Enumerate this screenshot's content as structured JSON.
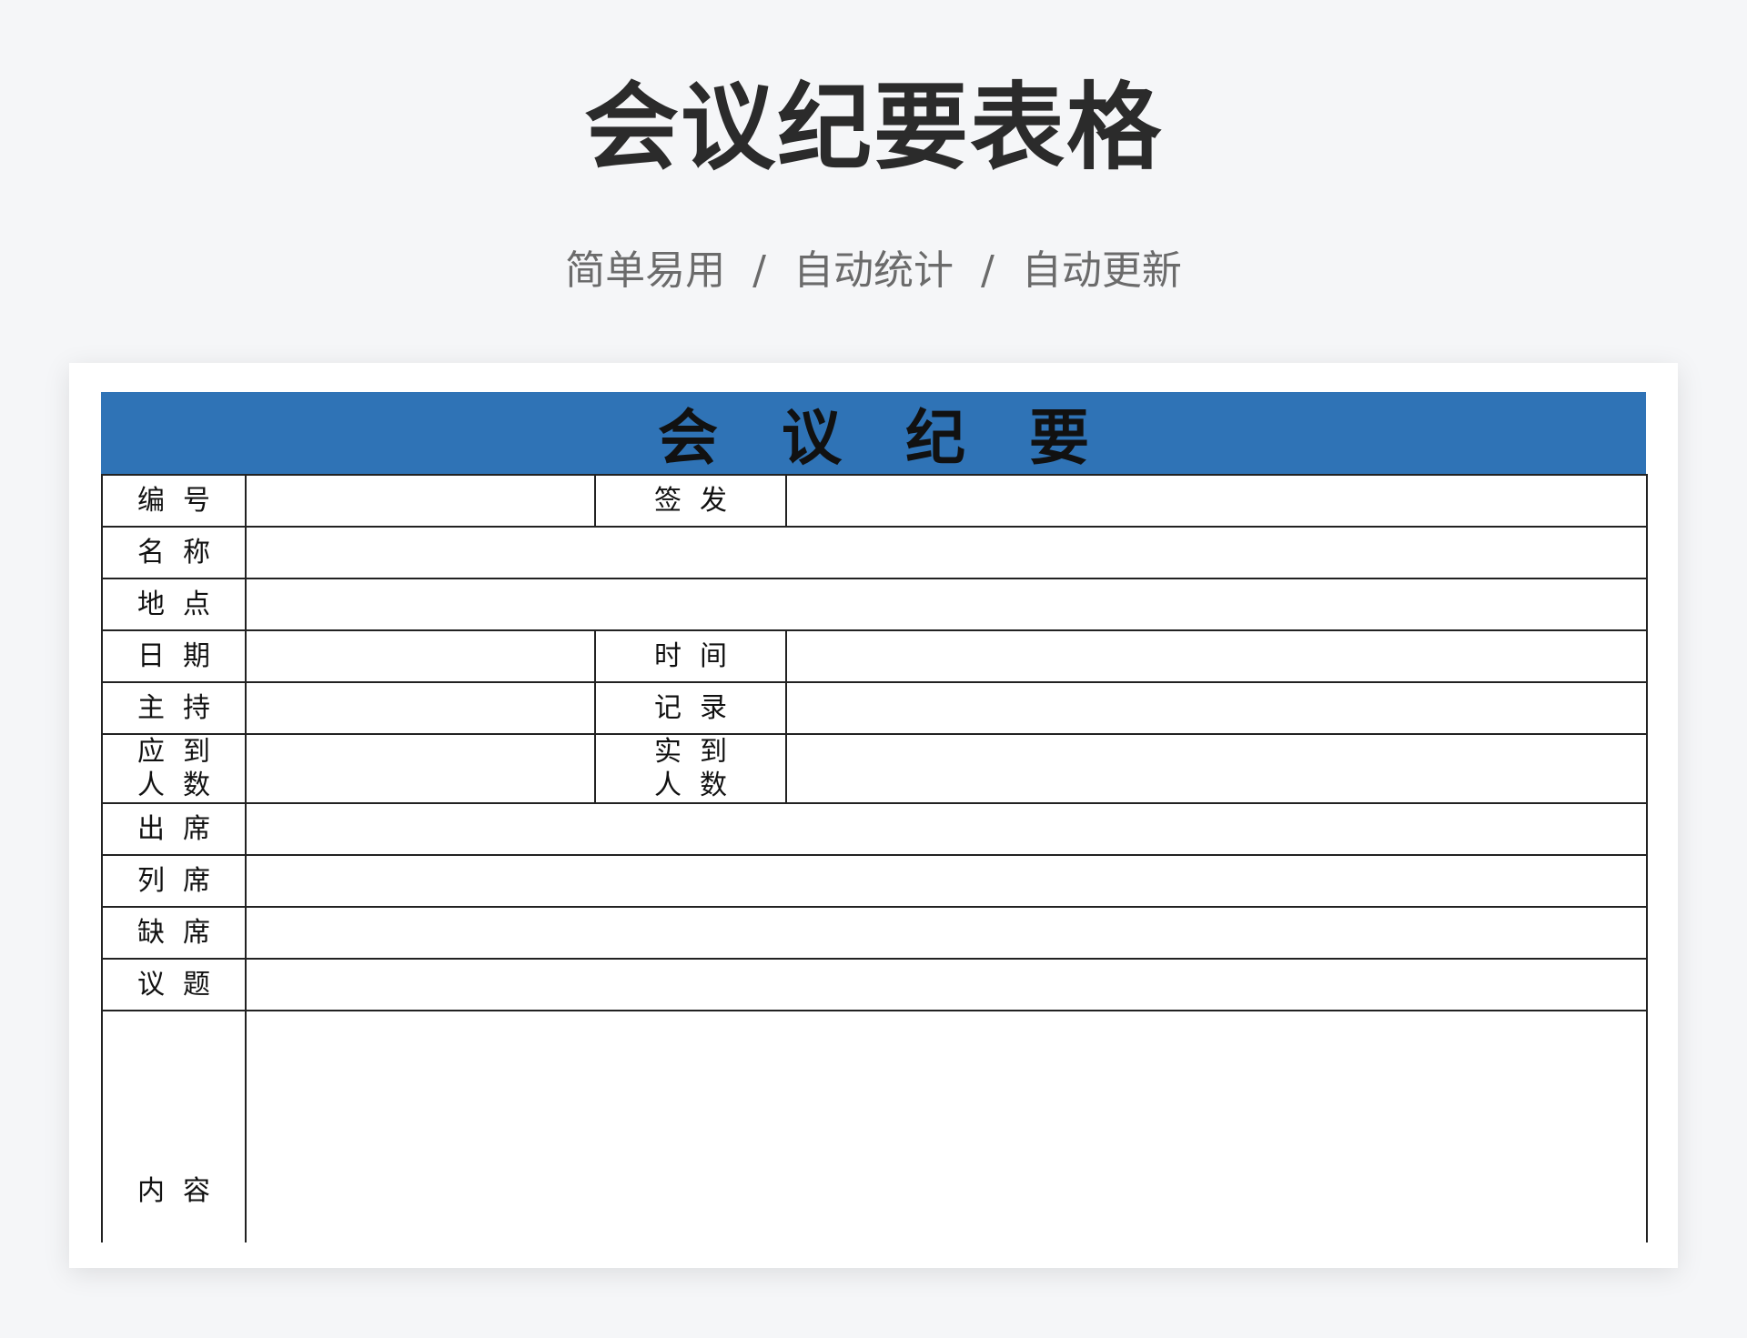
{
  "header": {
    "title": "会议纪要表格",
    "subtitle": [
      "简单易用",
      "自动统计",
      "自动更新"
    ],
    "separator": "/"
  },
  "form": {
    "banner": "会议纪要",
    "rows": {
      "number": {
        "label": "编号",
        "value": ""
      },
      "issuer": {
        "label": "签发",
        "value": ""
      },
      "name": {
        "label": "名称",
        "value": ""
      },
      "location": {
        "label": "地点",
        "value": ""
      },
      "date": {
        "label": "日期",
        "value": ""
      },
      "time": {
        "label": "时间",
        "value": ""
      },
      "host": {
        "label": "主持",
        "value": ""
      },
      "recorder": {
        "label": "记录",
        "value": ""
      },
      "expected": {
        "label_line1": "应到",
        "label_line2": "人数",
        "value": ""
      },
      "actual": {
        "label_line1": "实到",
        "label_line2": "人数",
        "value": ""
      },
      "present": {
        "label": "出席",
        "value": ""
      },
      "observers": {
        "label": "列席",
        "value": ""
      },
      "absent": {
        "label": "缺席",
        "value": ""
      },
      "topic": {
        "label": "议题",
        "value": ""
      },
      "content": {
        "label": "内容",
        "value": ""
      }
    }
  },
  "colors": {
    "banner": "#2f73b6",
    "background": "#f5f6f8"
  }
}
